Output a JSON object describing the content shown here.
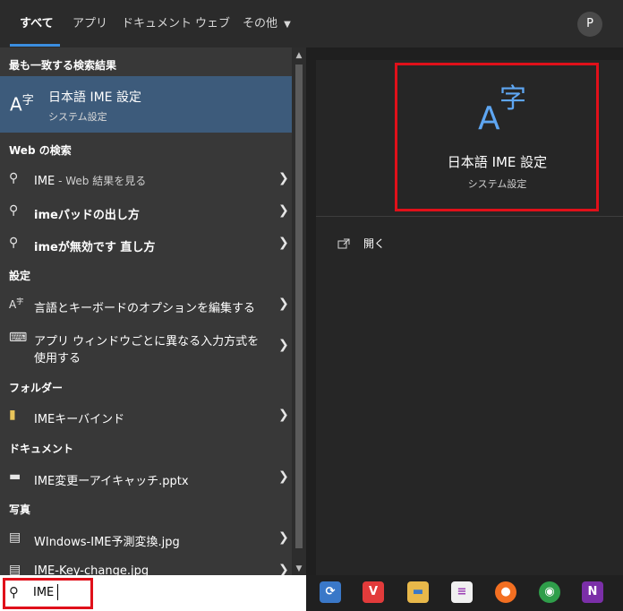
{
  "tabs": [
    "すべて",
    "アプリ",
    "ドキュメント",
    "ウェブ",
    "その他"
  ],
  "avatar_letter": "P",
  "best_match": {
    "header": "最も一致する検索結果",
    "title": "日本語 IME 設定",
    "subtitle": "システム設定"
  },
  "web": {
    "header": "Web の検索",
    "items": [
      {
        "label": "IME",
        "suffix": " - Web 結果を見る"
      },
      {
        "label": "imeパッドの出し方"
      },
      {
        "label": "imeが無効です 直し方"
      }
    ]
  },
  "settings": {
    "header": "設定",
    "items": [
      {
        "label": "言語とキーボードのオプションを編集する"
      },
      {
        "label_line1": "アプリ ウィンドウごとに異なる入力方式を",
        "label_line2": "使用する"
      }
    ]
  },
  "folders": {
    "header": "フォルダー",
    "items": [
      {
        "label": "IMEキーバインド"
      }
    ]
  },
  "documents": {
    "header": "ドキュメント",
    "items": [
      {
        "label": "IME変更ーアイキャッチ.pptx"
      }
    ]
  },
  "photos": {
    "header": "写真",
    "items": [
      {
        "label": "WIndows-IME予測変換.jpg"
      },
      {
        "label": "IME-Key-change.jpg"
      }
    ]
  },
  "preview": {
    "title": "日本語 IME 設定",
    "subtitle": "システム設定",
    "open_label": "開く"
  },
  "search": {
    "value": "IME"
  },
  "taskbar_icons": [
    "remote-desktop-icon",
    "vivaldi-icon",
    "file-explorer-icon",
    "notepad-icon",
    "firefox-icon",
    "chrome-icon",
    "onenote-icon"
  ],
  "colors": {
    "highlight": "#3d5b7b",
    "accent": "#3b8ee0",
    "annotation_red": "#e0101a"
  }
}
